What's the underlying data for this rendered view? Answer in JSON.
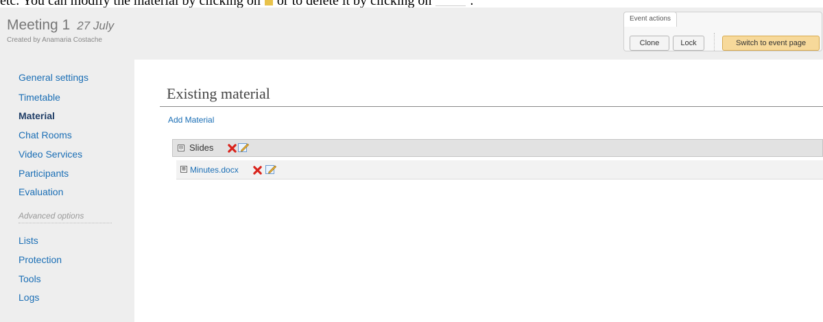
{
  "caption": {
    "part1": "etc. You can modify the material by clicking on",
    "part2": "or to delete it by clicking on",
    "part3": "."
  },
  "header": {
    "title": "Meeting 1",
    "date": "27 July",
    "creator": "Created by Anamaria Costache"
  },
  "event_actions": {
    "label": "Event actions",
    "clone": "Clone",
    "lock": "Lock",
    "switch": "Switch to event page"
  },
  "sidebar": {
    "items": [
      {
        "label": "General settings",
        "active": false
      },
      {
        "label": "Timetable",
        "active": false
      },
      {
        "label": "Material",
        "active": true
      },
      {
        "label": "Chat Rooms",
        "active": false
      },
      {
        "label": "Video Services",
        "active": false
      },
      {
        "label": "Participants",
        "active": false
      },
      {
        "label": "Evaluation",
        "active": false
      }
    ],
    "advanced_heading": "Advanced options",
    "advanced_items": [
      {
        "label": "Lists"
      },
      {
        "label": "Protection"
      },
      {
        "label": "Tools"
      },
      {
        "label": "Logs"
      }
    ]
  },
  "main": {
    "section_title": "Existing material",
    "add_material": "Add Material",
    "category": {
      "toggle": "⊟",
      "label": "Slides"
    },
    "file": {
      "toggle": "⊞",
      "label": "Minutes.docx"
    }
  },
  "colors": {
    "link": "#1a6eb5",
    "active_nav": "#1f3d66",
    "switch_button": "#f7d99a",
    "delete_icon": "#d9231c"
  },
  "icons": [
    "delete-icon",
    "edit-icon",
    "collapse-icon",
    "expand-icon"
  ]
}
